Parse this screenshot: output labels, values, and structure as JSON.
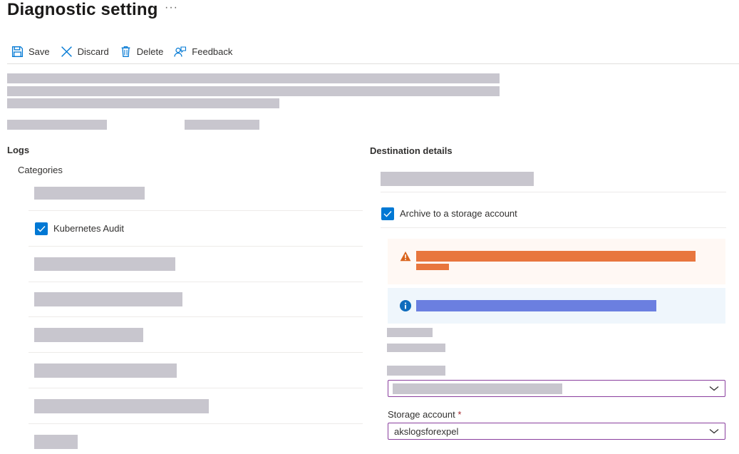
{
  "page": {
    "title": "Diagnostic setting",
    "more": "···"
  },
  "toolbar": {
    "save": "Save",
    "discard": "Discard",
    "delete": "Delete",
    "feedback": "Feedback"
  },
  "logs": {
    "heading": "Logs",
    "categories_label": "Categories",
    "checked_item": "Kubernetes Audit"
  },
  "destination": {
    "heading": "Destination details",
    "archive_label": "Archive to a storage account",
    "storage_label": "Storage account",
    "required_mark": "*",
    "storage_value": "akslogsforexpel"
  },
  "colors": {
    "accent": "#0078d4",
    "warning": "#e8763e",
    "info_bar": "#6b7fe0",
    "focus_border": "#8a3f9e",
    "redaction": "#c8c6ce"
  },
  "icons": {
    "save": "save-icon",
    "discard": "close-icon",
    "delete": "trash-icon",
    "feedback": "feedback-icon",
    "warning": "warning-icon",
    "info": "info-icon",
    "chevron": "chevron-down-icon"
  }
}
